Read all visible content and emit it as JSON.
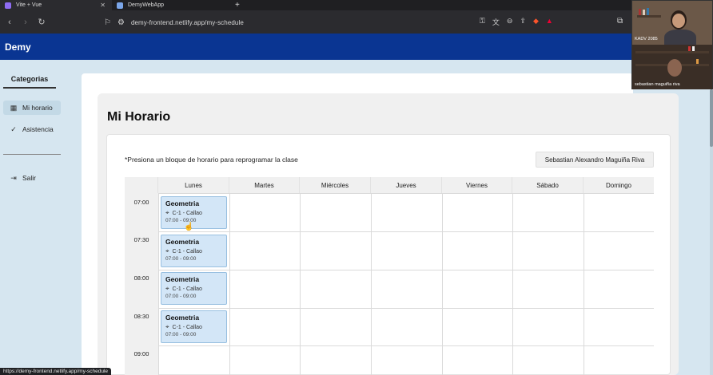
{
  "browser": {
    "tabs": [
      {
        "label": "Vite + Vue",
        "active": true
      },
      {
        "label": "DemyWebApp",
        "active": false
      }
    ],
    "url": "demy-frontend.netlify.app/my-schedule",
    "status_url": "https://demy-frontend.netlify.app/my-schedule"
  },
  "app": {
    "brand": "Demy"
  },
  "sidebar": {
    "title": "Categorias",
    "items": [
      {
        "label": "Mi horario",
        "icon": "calendar-icon",
        "active": true
      },
      {
        "label": "Asistencia",
        "icon": "check-circle-icon",
        "active": false
      },
      {
        "label": "Salir",
        "icon": "logout-icon",
        "active": false
      }
    ]
  },
  "page": {
    "title": "Mi Horario",
    "hint": "*Presiona un bloque de horario para reprogramar la clase",
    "user_name": "Sebastian Alexandro Maguiña Riva"
  },
  "schedule": {
    "days": [
      "Lunes",
      "Martes",
      "Miércoles",
      "Jueves",
      "Viernes",
      "Sábado",
      "Domingo"
    ],
    "times": [
      "07:00",
      "07:30",
      "08:00",
      "08:30",
      "09:00"
    ],
    "blocks": [
      {
        "day": "Lunes",
        "slot": "07:00",
        "title": "Geometria",
        "location": "C-1 - Callao",
        "time": "07:00 - 09:00"
      },
      {
        "day": "Lunes",
        "slot": "07:30",
        "title": "Geometria",
        "location": "C-1 - Callao",
        "time": "07:00 - 09:00"
      },
      {
        "day": "Lunes",
        "slot": "08:00",
        "title": "Geometria",
        "location": "C-1 - Callao",
        "time": "07:00 - 09:00"
      },
      {
        "day": "Lunes",
        "slot": "08:30",
        "title": "Geometria",
        "location": "C-1 - Callao",
        "time": "07:00 - 09:00"
      }
    ]
  },
  "webcam": {
    "top_label": "KADV 2085",
    "bottom_label": "sebastian maguiña riva"
  },
  "colors": {
    "header": "#0a3592",
    "page_bg": "#d6e6f0",
    "block_bg": "#d3e6f7",
    "block_border": "#97bfe0"
  }
}
